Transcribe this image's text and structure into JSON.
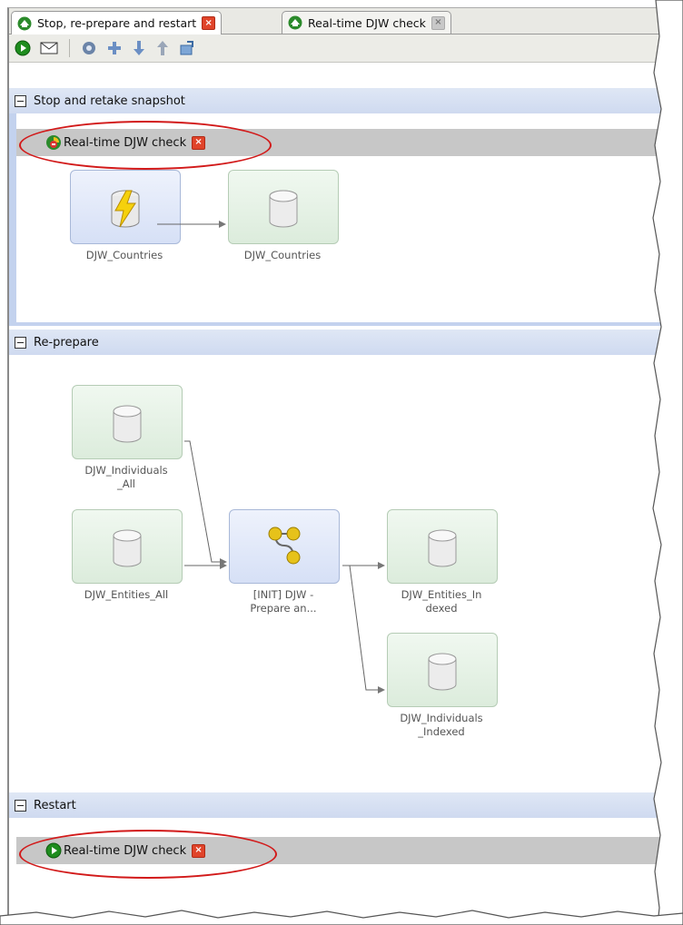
{
  "tabs": [
    {
      "label": "Stop, re-prepare and restart",
      "active": true,
      "close": "red"
    },
    {
      "label": "Real-time DJW check",
      "active": false,
      "close": "grey"
    }
  ],
  "toolbar": {
    "icons": [
      "run-icon",
      "email-icon",
      "settings-icon",
      "add-icon",
      "move-down-icon",
      "move-up-icon",
      "export-icon"
    ]
  },
  "sections": {
    "stop": {
      "title": "Stop and retake snapshot",
      "task_label": "Real-time DJW check",
      "nodes": [
        {
          "label": "DJW_Countries",
          "kind": "source-realtime"
        },
        {
          "label": "DJW_Countries",
          "kind": "snapshot"
        }
      ]
    },
    "reprepare": {
      "title": "Re-prepare",
      "nodes": [
        {
          "label": "DJW_Individuals\n_All"
        },
        {
          "label": "DJW_Entities_All"
        },
        {
          "label": "[INIT] DJW -\nPrepare an..."
        },
        {
          "label": "DJW_Entities_In\ndexed"
        },
        {
          "label": "DJW_Individuals\n_Indexed"
        }
      ]
    },
    "restart": {
      "title": "Restart",
      "task_label": "Real-time DJW check"
    }
  },
  "colors": {
    "highlight": "#d21a1a",
    "close_red": "#e0442a",
    "section_blue": "#d4def2",
    "task_bar": "#c7c7c7"
  }
}
